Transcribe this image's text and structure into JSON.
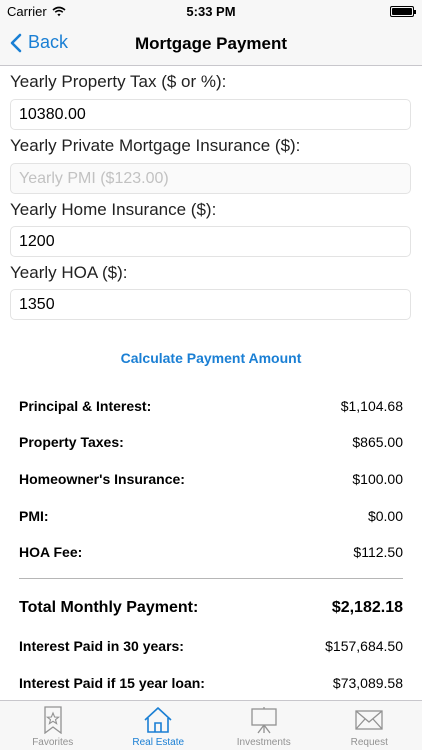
{
  "status_bar": {
    "carrier": "Carrier",
    "time": "5:33 PM"
  },
  "nav": {
    "back_label": "Back",
    "title": "Mortgage Payment"
  },
  "fields": [
    {
      "label": "Yearly Property Tax ($ or %):",
      "value": "10380.00",
      "placeholder": ""
    },
    {
      "label": "Yearly Private Mortgage Insurance ($):",
      "value": "",
      "placeholder": "Yearly PMI ($123.00)"
    },
    {
      "label": "Yearly Home Insurance ($):",
      "value": "1200",
      "placeholder": ""
    },
    {
      "label": "Yearly HOA ($):",
      "value": "1350",
      "placeholder": ""
    }
  ],
  "calculate_label": "Calculate Payment Amount",
  "results": [
    {
      "label": "Principal & Interest:",
      "value": "$1,104.68"
    },
    {
      "label": "Property Taxes:",
      "value": "$865.00"
    },
    {
      "label": "Homeowner's Insurance:",
      "value": "$100.00"
    },
    {
      "label": "PMI:",
      "value": "$0.00"
    },
    {
      "label": "HOA Fee:",
      "value": "$112.50"
    }
  ],
  "totals": [
    {
      "label": "Total Monthly Payment:",
      "value": "$2,182.18"
    },
    {
      "label": "Interest Paid in 30 years:",
      "value": "$157,684.50"
    },
    {
      "label": "Interest Paid if 15 year loan:",
      "value": "$73,089.58"
    }
  ],
  "tabs": [
    {
      "label": "Favorites",
      "icon": "star-icon",
      "active": false
    },
    {
      "label": "Real Estate",
      "icon": "house-icon",
      "active": true
    },
    {
      "label": "Investments",
      "icon": "easel-icon",
      "active": false
    },
    {
      "label": "Request",
      "icon": "envelope-icon",
      "active": false
    }
  ],
  "colors": {
    "accent": "#1a7fd4",
    "inactive_tab": "#929292",
    "bar_background": "#f7f7f7"
  }
}
